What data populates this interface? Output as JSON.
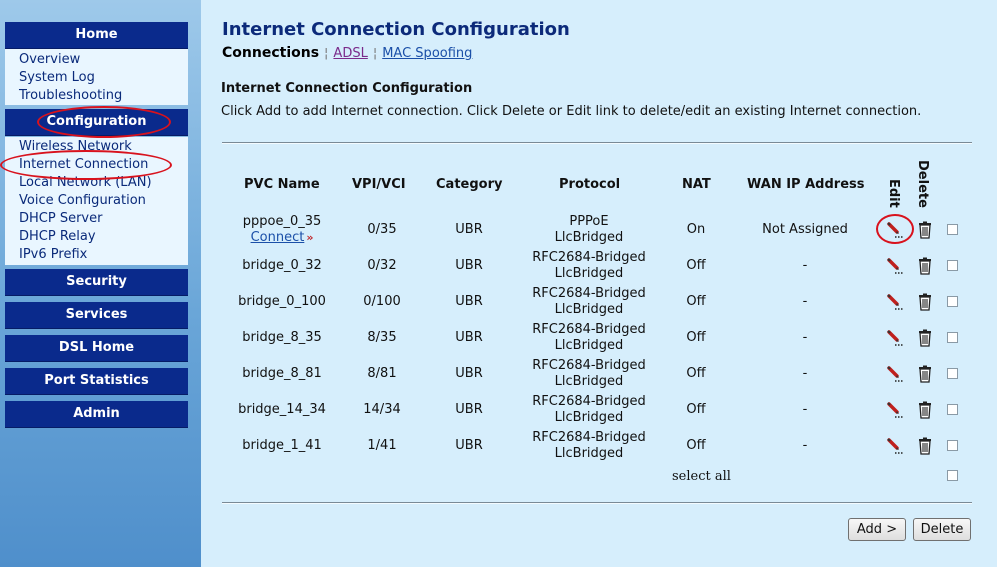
{
  "sidebar": {
    "home": {
      "label": "Home",
      "items": [
        "Overview",
        "System Log",
        "Troubleshooting"
      ]
    },
    "configuration": {
      "label": "Configuration",
      "items": [
        "Wireless Network",
        "Internet Connection",
        "Local Network (LAN)",
        "Voice Configuration",
        "DHCP Server",
        "DHCP Relay",
        "IPv6 Prefix"
      ]
    },
    "sections": [
      "Security",
      "Services",
      "DSL Home",
      "Port Statistics",
      "Admin"
    ]
  },
  "page_title": "Internet Connection Configuration",
  "tabs": {
    "active": "Connections",
    "links": [
      "ADSL",
      "MAC Spoofing"
    ]
  },
  "section_title": "Internet Connection Configuration",
  "instructions": "Click Add to add Internet connection. Click Delete or Edit link to delete/edit an existing Internet connection.",
  "table": {
    "headers": {
      "pvc_name": "PVC Name",
      "vpi_vci": "VPI/VCI",
      "category": "Category",
      "protocol": "Protocol",
      "nat": "NAT",
      "wan_ip": "WAN IP Address",
      "edit": "Edit",
      "delete": "Delete"
    },
    "rows": [
      {
        "pvc_name": "pppoe_0_35",
        "link": "Connect",
        "vpi_vci": "0/35",
        "category": "UBR",
        "protocol_1": "PPPoE",
        "protocol_2": "LlcBridged",
        "nat": "On",
        "wan_ip": "Not Assigned"
      },
      {
        "pvc_name": "bridge_0_32",
        "vpi_vci": "0/32",
        "category": "UBR",
        "protocol_1": "RFC2684-Bridged",
        "protocol_2": "LlcBridged",
        "nat": "Off",
        "wan_ip": "-"
      },
      {
        "pvc_name": "bridge_0_100",
        "vpi_vci": "0/100",
        "category": "UBR",
        "protocol_1": "RFC2684-Bridged",
        "protocol_2": "LlcBridged",
        "nat": "Off",
        "wan_ip": "-"
      },
      {
        "pvc_name": "bridge_8_35",
        "vpi_vci": "8/35",
        "category": "UBR",
        "protocol_1": "RFC2684-Bridged",
        "protocol_2": "LlcBridged",
        "nat": "Off",
        "wan_ip": "-"
      },
      {
        "pvc_name": "bridge_8_81",
        "vpi_vci": "8/81",
        "category": "UBR",
        "protocol_1": "RFC2684-Bridged",
        "protocol_2": "LlcBridged",
        "nat": "Off",
        "wan_ip": "-"
      },
      {
        "pvc_name": "bridge_14_34",
        "vpi_vci": "14/34",
        "category": "UBR",
        "protocol_1": "RFC2684-Bridged",
        "protocol_2": "LlcBridged",
        "nat": "Off",
        "wan_ip": "-"
      },
      {
        "pvc_name": "bridge_1_41",
        "vpi_vci": "1/41",
        "category": "UBR",
        "protocol_1": "RFC2684-Bridged",
        "protocol_2": "LlcBridged",
        "nat": "Off",
        "wan_ip": "-"
      }
    ],
    "select_all_label": "select all"
  },
  "buttons": {
    "add": "Add >",
    "delete": "Delete"
  },
  "colors": {
    "nav_header": "#0a2a8c",
    "page_bg": "#d6eefc",
    "annotation_ring": "#d8121d",
    "link": "#1a4fa8"
  }
}
